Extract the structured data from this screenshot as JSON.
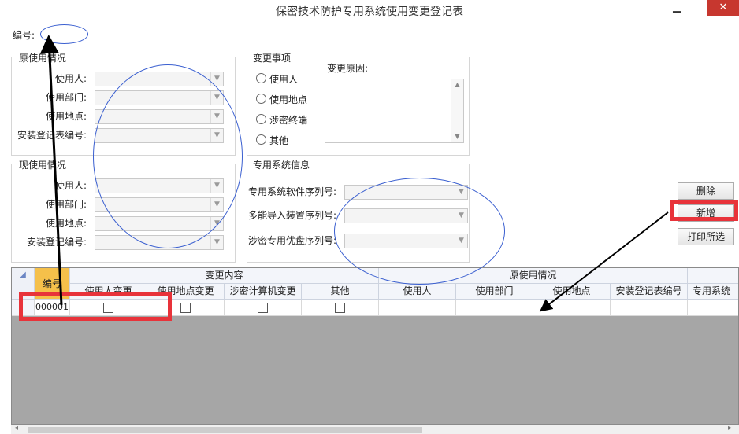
{
  "window": {
    "title": "保密技术防护专用系统使用变更登记表",
    "minimize": "▁",
    "close": "✕"
  },
  "serial_label": "编号:",
  "original_usage": {
    "title": "原使用情况",
    "fields": [
      "使用人:",
      "使用部门:",
      "使用地点:",
      "安装登记表编号:"
    ]
  },
  "current_usage": {
    "title": "现使用情况",
    "fields": [
      "使用人:",
      "使用部门:",
      "使用地点:",
      "安装登记编号:"
    ]
  },
  "change_items": {
    "title": "变更事项",
    "options": [
      "使用人",
      "使用地点",
      "涉密终端",
      "其他"
    ],
    "reason_label": "变更原因:"
  },
  "system_info": {
    "title": "专用系统信息",
    "fields": [
      "专用系统软件序列号:",
      "多能导入装置序列号:",
      "涉密专用优盘序列号:"
    ]
  },
  "buttons": {
    "delete": "删除",
    "add": "新增",
    "print": "打印所选"
  },
  "grid": {
    "corner": "◢",
    "col_id": "编号",
    "group_change": "变更内容",
    "group_original": "原使用情况",
    "change_cols": [
      "使用人变更",
      "使用地点变更",
      "涉密计算机变更",
      "其他"
    ],
    "original_cols": [
      "使用人",
      "使用部门",
      "使用地点",
      "安装登记表编号",
      "专用系统"
    ],
    "rows": [
      {
        "id": "000001"
      }
    ]
  },
  "scroll": {
    "left": "◂",
    "right": "▸"
  },
  "colors": {
    "annotation_red": "#e8333a",
    "annotation_blue": "#3a5fd0",
    "id_header": "#f5c04a"
  }
}
